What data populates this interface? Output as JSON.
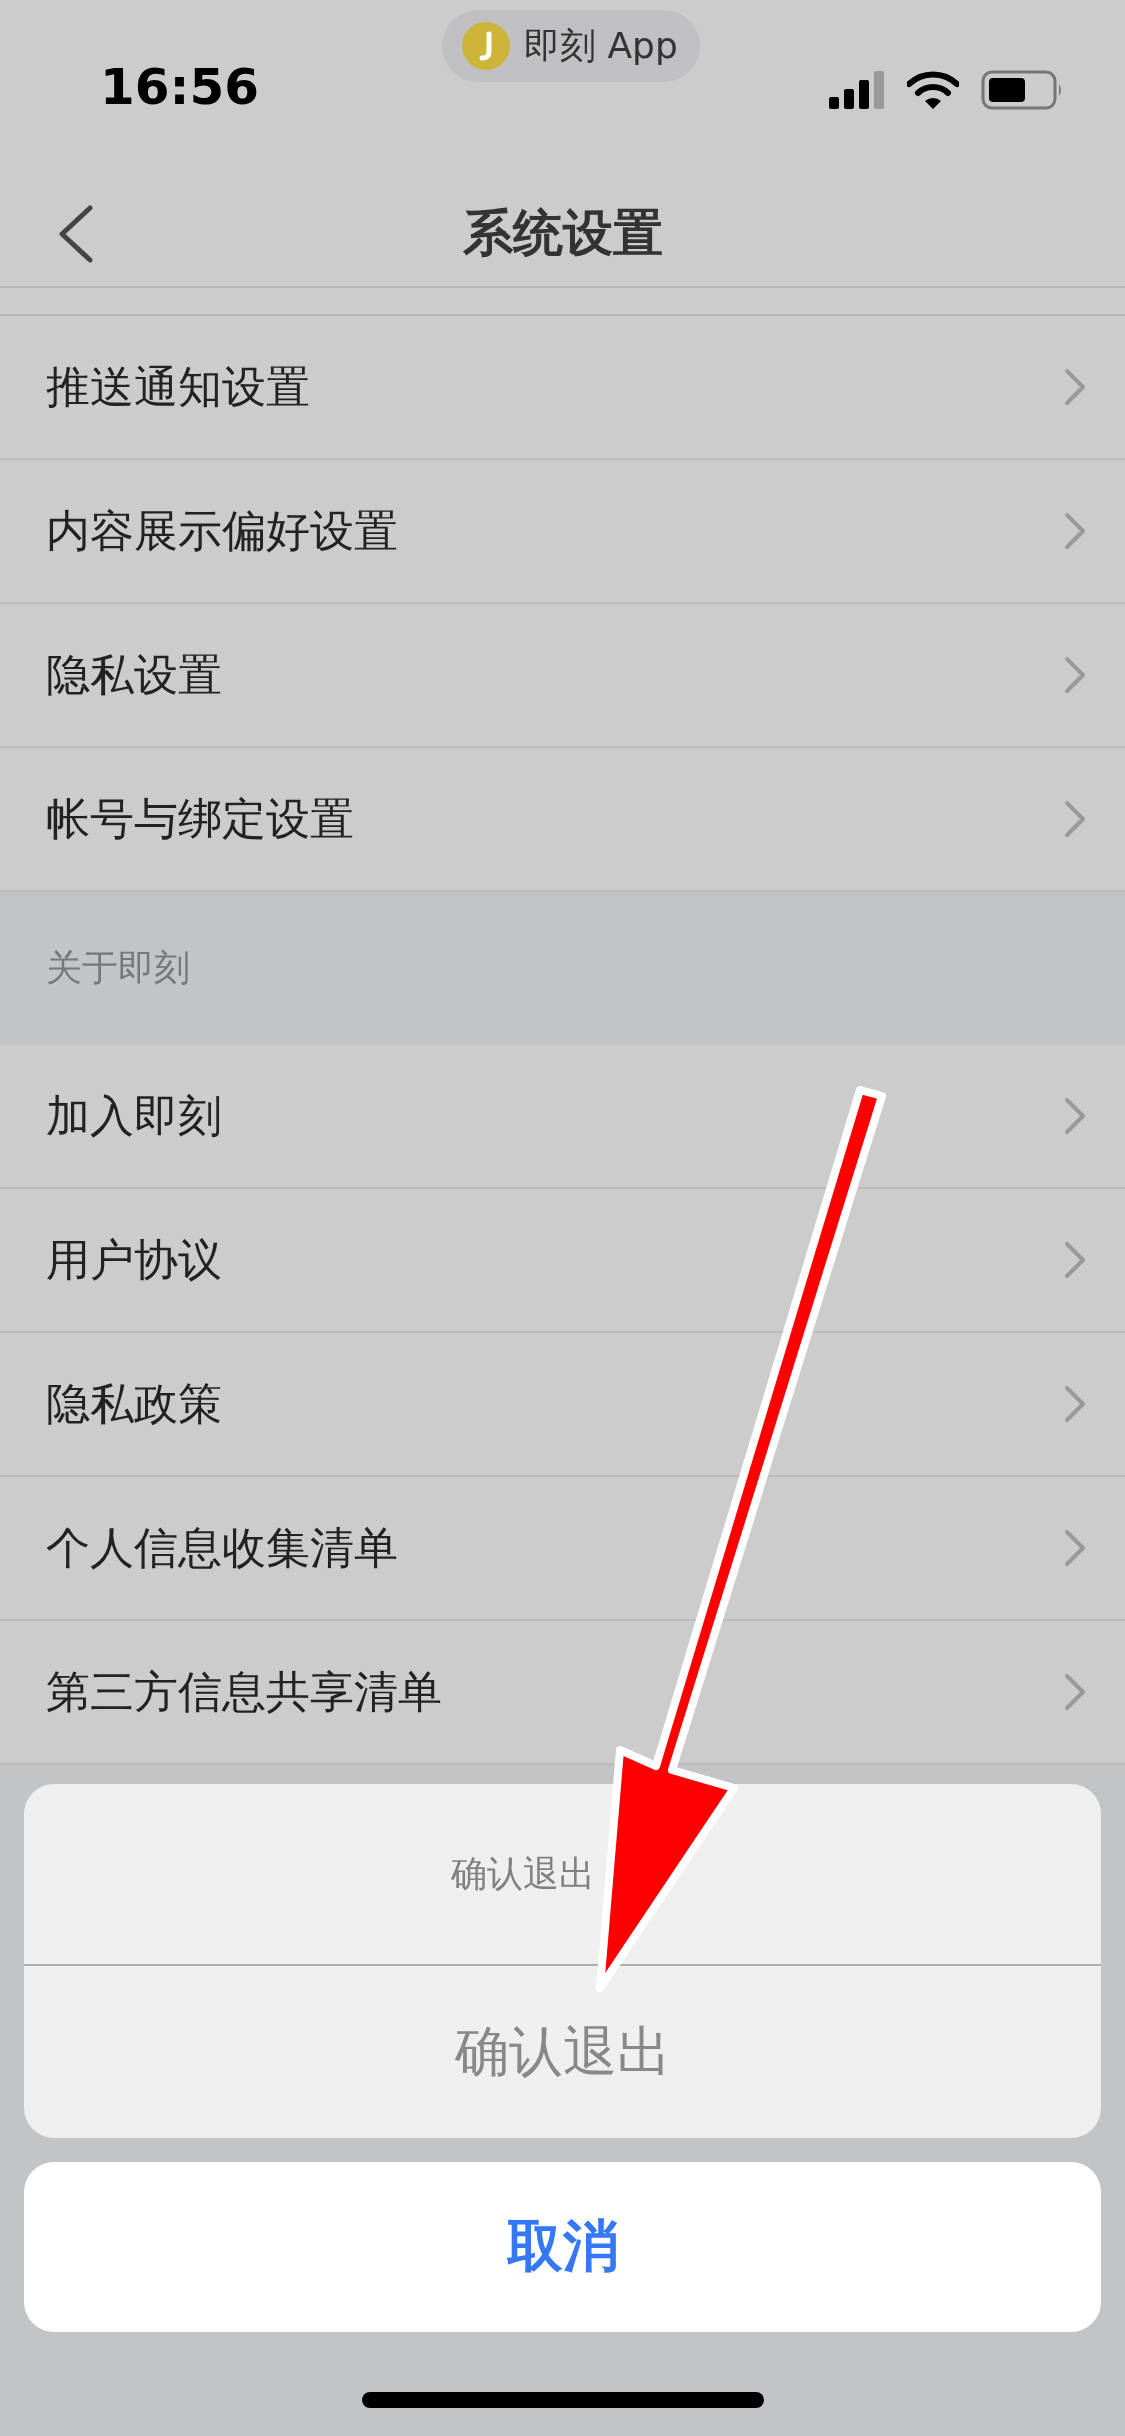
{
  "status_bar": {
    "time": "16:56",
    "app_pill": "即刻 App"
  },
  "nav": {
    "title": "系统设置"
  },
  "groups": [
    {
      "items": [
        {
          "label": "推送通知设置"
        },
        {
          "label": "内容展示偏好设置"
        },
        {
          "label": "隐私设置"
        },
        {
          "label": "帐号与绑定设置"
        }
      ]
    },
    {
      "header": "关于即刻",
      "items": [
        {
          "label": "加入即刻"
        },
        {
          "label": "用户协议"
        },
        {
          "label": "隐私政策"
        },
        {
          "label": "个人信息收集清单"
        },
        {
          "label": "第三方信息共享清单"
        }
      ]
    }
  ],
  "action_sheet": {
    "title": "确认退出",
    "confirm": "确认退出",
    "cancel": "取消"
  }
}
